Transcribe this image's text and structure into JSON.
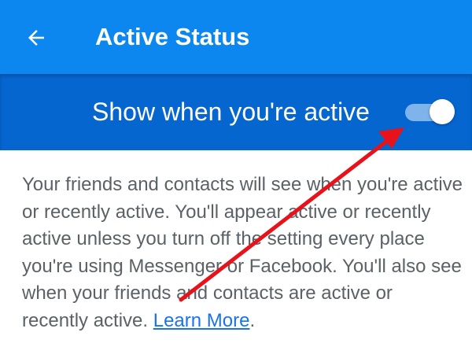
{
  "header": {
    "title": "Active Status",
    "back_icon": "arrow-back-icon"
  },
  "toggle_row": {
    "label": "Show when you're active",
    "checked": true
  },
  "description": {
    "text": "Your friends and contacts will see when you're active or recently active. You'll appear active or recently active unless you turn off the setting every place you're using Messenger or Facebook. You'll also see when your friends and contacts are active or recently active. ",
    "link_label": "Learn More",
    "trailing": "."
  },
  "colors": {
    "app_bar": "#0c87f0",
    "toggle_row": "#0566d0",
    "link": "#1a73e8",
    "annotation_arrow": "#e8121b"
  }
}
